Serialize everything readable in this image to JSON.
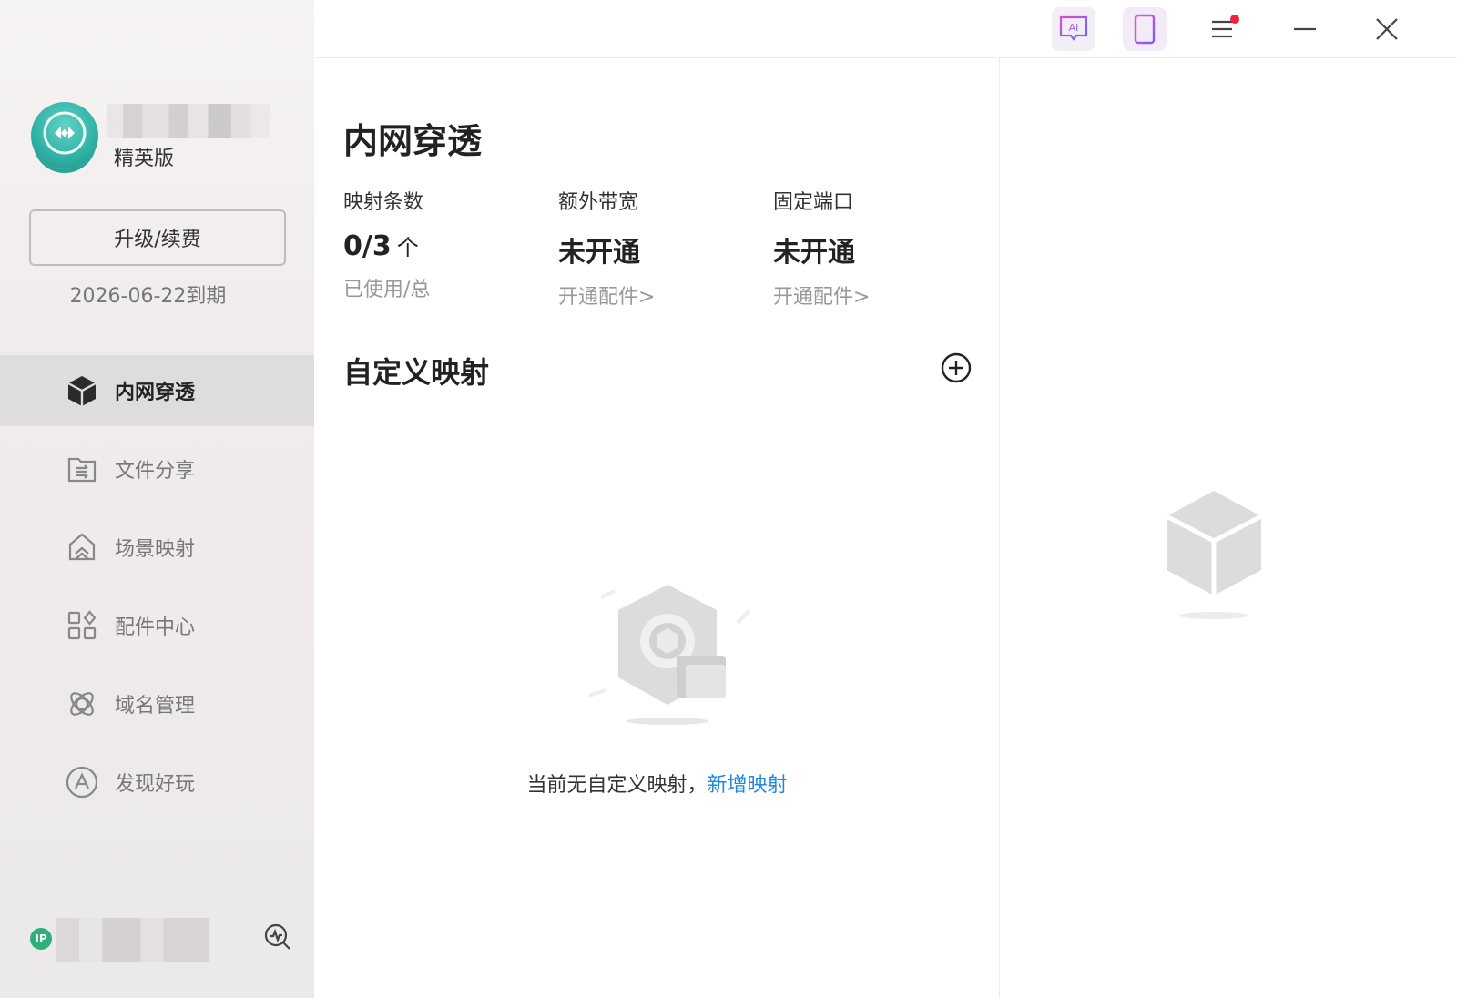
{
  "sidebar": {
    "plan": "精英版",
    "upgrade_label": "升级/续费",
    "expire_text": "2026-06-22到期",
    "items": [
      {
        "label": "内网穿透",
        "icon": "cube-icon",
        "active": true
      },
      {
        "label": "文件分享",
        "icon": "folder-share-icon",
        "active": false
      },
      {
        "label": "场景映射",
        "icon": "scene-home-icon",
        "active": false
      },
      {
        "label": "配件中心",
        "icon": "apps-grid-icon",
        "active": false
      },
      {
        "label": "域名管理",
        "icon": "atom-icon",
        "active": false
      },
      {
        "label": "发现好玩",
        "icon": "compass-a-icon",
        "active": false
      }
    ],
    "footer": {
      "ip_badge": "IP"
    }
  },
  "topbar": {
    "ai_label": "AI"
  },
  "main": {
    "title": "内网穿透",
    "stats": [
      {
        "label": "映射条数",
        "value": "0/3",
        "unit": "个",
        "sub": "已使用/总"
      },
      {
        "label": "额外带宽",
        "value": "未开通",
        "unit": "",
        "sub": "开通配件>"
      },
      {
        "label": "固定端口",
        "value": "未开通",
        "unit": "",
        "sub": "开通配件>"
      }
    ],
    "section_title": "自定义映射",
    "empty_text": "当前无自定义映射，",
    "empty_link": "新增映射"
  },
  "colors": {
    "accent_link": "#1e88e5",
    "active_nav_bg": "#dedcdc",
    "notification_dot": "#f0243c",
    "ip_badge": "#2fb07a"
  }
}
